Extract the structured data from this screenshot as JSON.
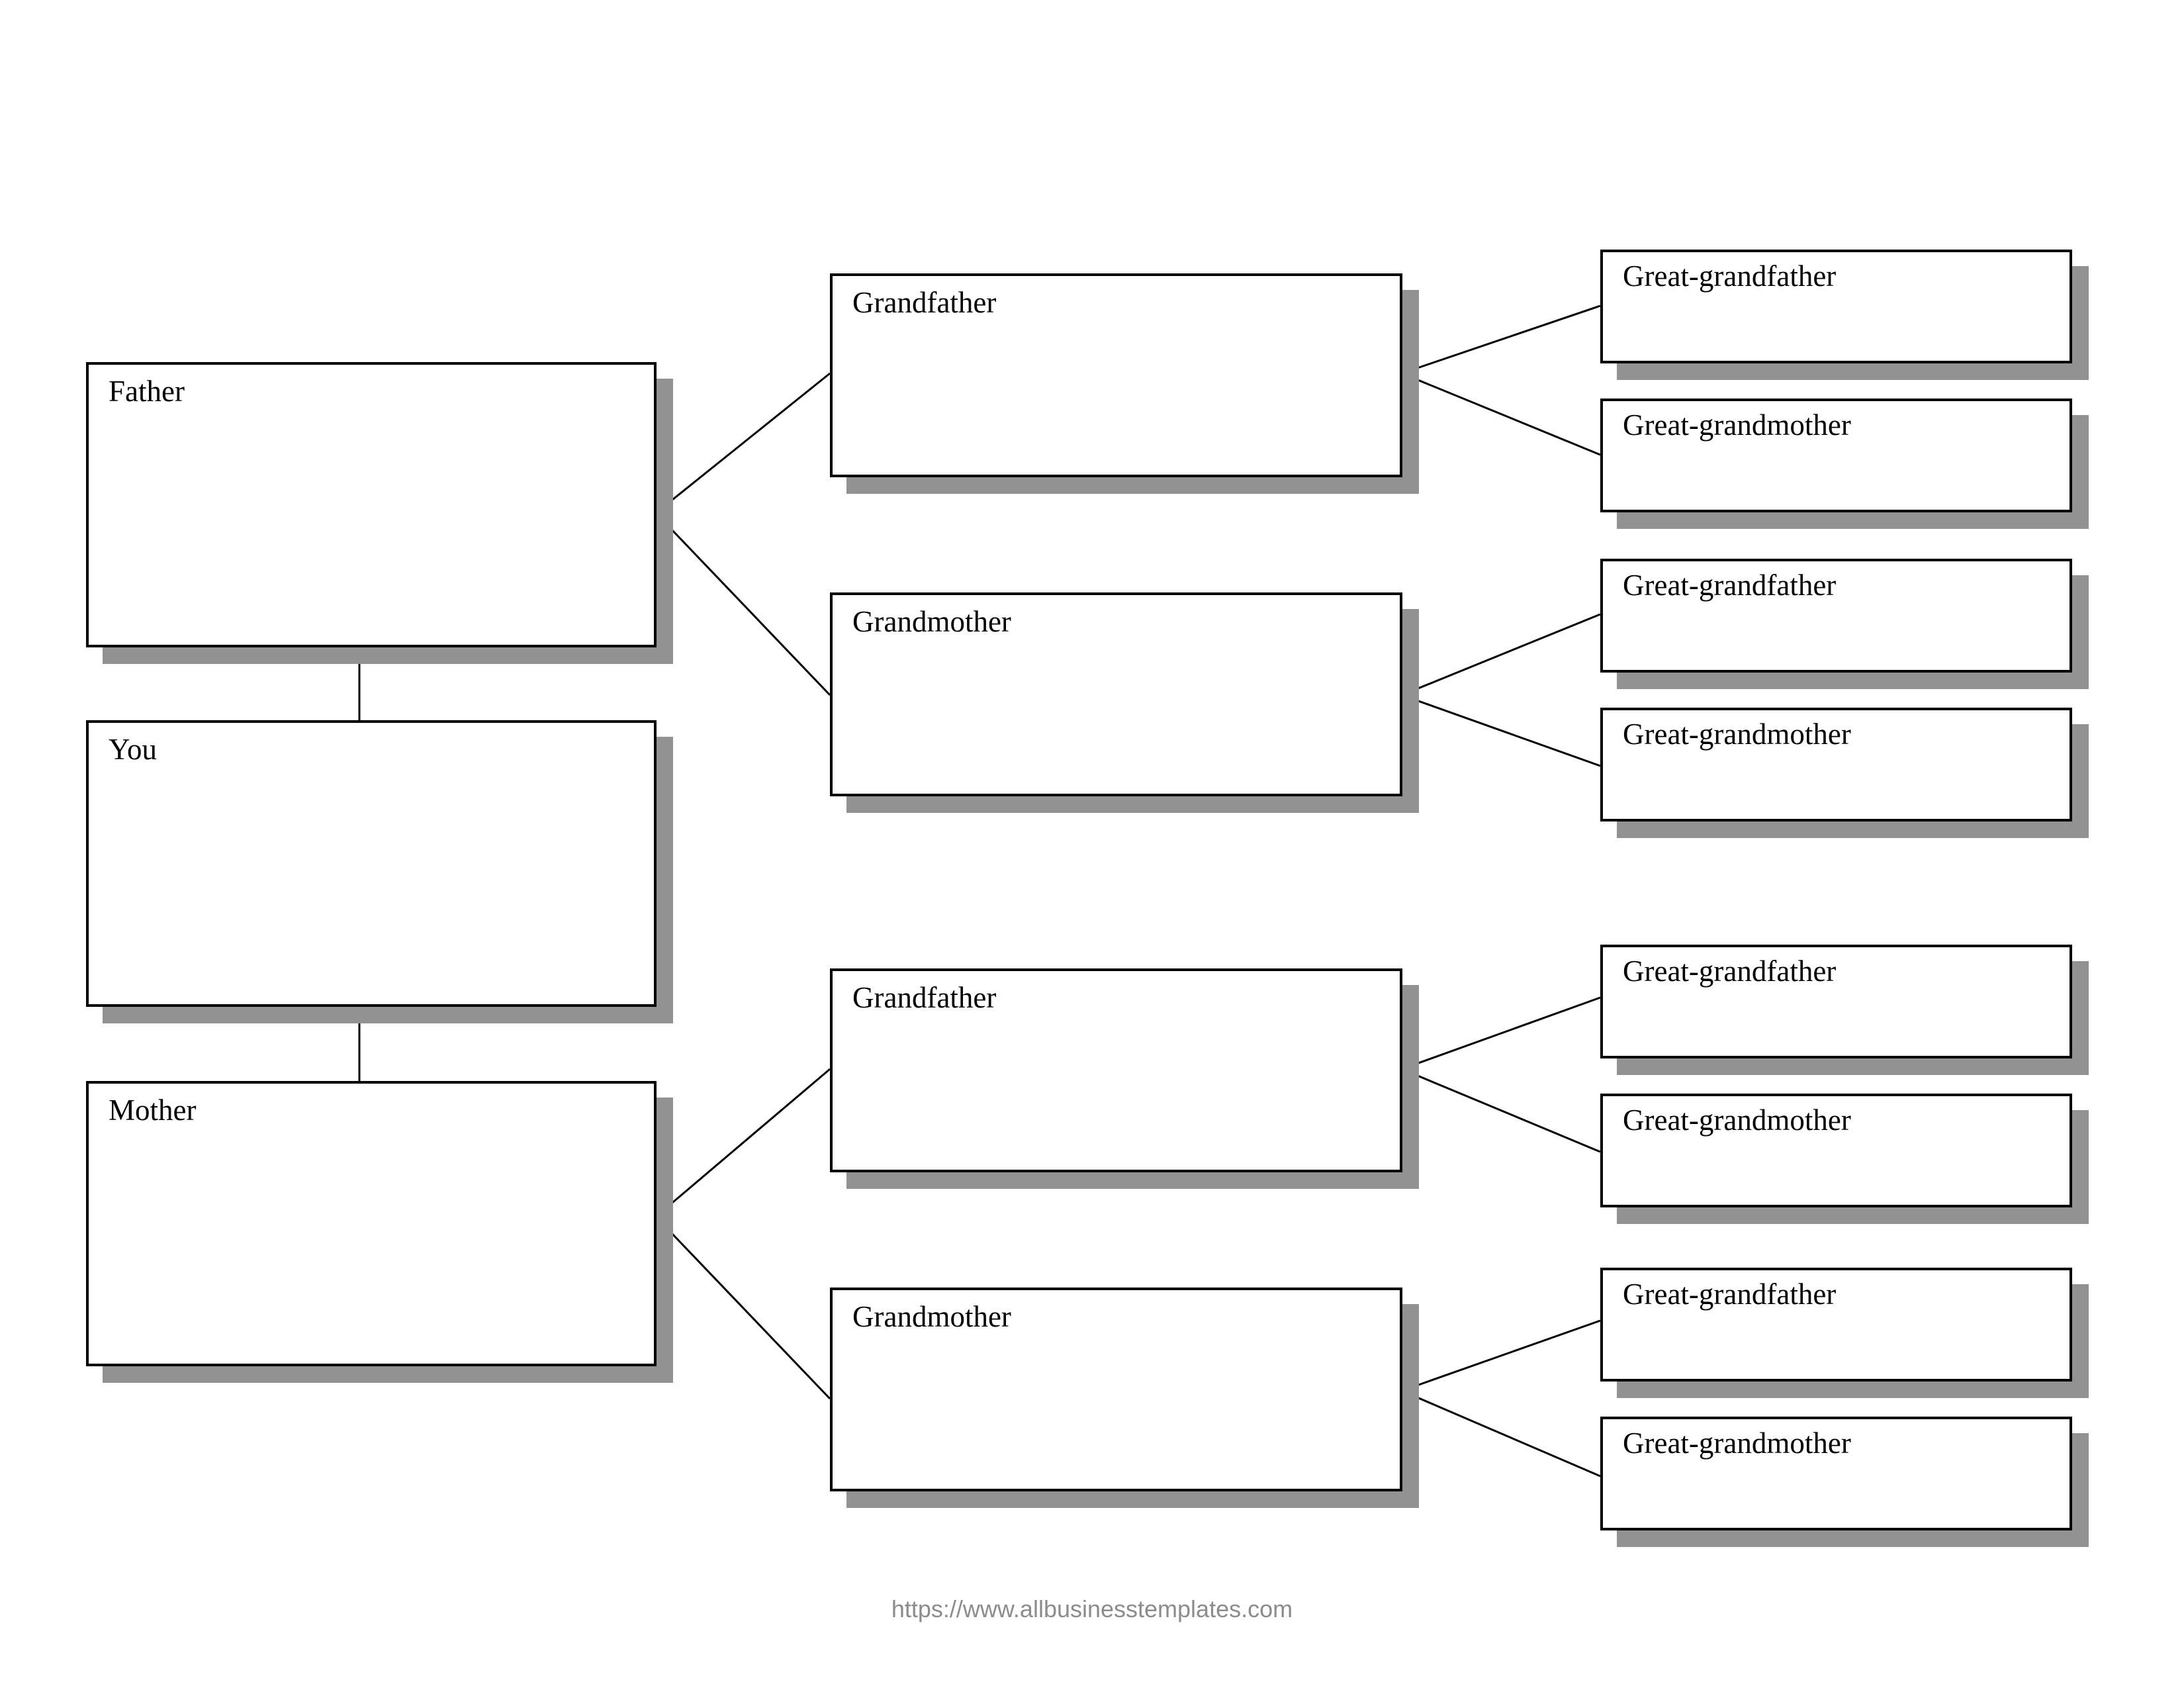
{
  "tree": {
    "self": {
      "label": "You"
    },
    "parents": [
      {
        "label": "Father"
      },
      {
        "label": "Mother"
      }
    ],
    "grandparents": [
      {
        "label": "Grandfather"
      },
      {
        "label": "Grandmother"
      },
      {
        "label": "Grandfather"
      },
      {
        "label": "Grandmother"
      }
    ],
    "great_grandparents": [
      {
        "label": "Great-grandfather"
      },
      {
        "label": "Great-grandmother"
      },
      {
        "label": "Great-grandfather"
      },
      {
        "label": "Great-grandmother"
      },
      {
        "label": "Great-grandfather"
      },
      {
        "label": "Great-grandmother"
      },
      {
        "label": "Great-grandfather"
      },
      {
        "label": "Great-grandmother"
      }
    ]
  },
  "footer": {
    "url": "https://www.allbusinesstemplates.com"
  }
}
